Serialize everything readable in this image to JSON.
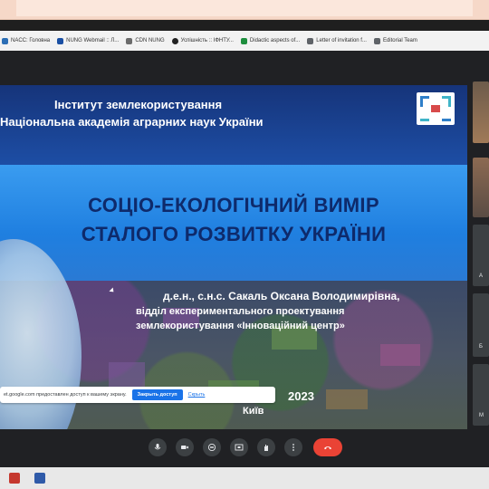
{
  "browser": {
    "bookmarks": [
      {
        "label": "NACC: Головна",
        "icon": "nacc-icon",
        "color": "#2c6eb5"
      },
      {
        "label": "NUNG Webmail :: Л...",
        "icon": "mail-icon",
        "color": "#1a4fa3"
      },
      {
        "label": "CDN NUNG",
        "icon": "doc-icon",
        "color": "#6b6b6b"
      },
      {
        "label": "Успішність :: ІФНТУ...",
        "icon": "github-icon",
        "color": "#222222"
      },
      {
        "label": "Didactic aspects of...",
        "icon": "sheet-icon",
        "color": "#1e8e3e"
      },
      {
        "label": "Letter of invitation f...",
        "icon": "letter-icon",
        "color": "#5f6368"
      },
      {
        "label": "Editorial Team",
        "icon": "editorial-icon",
        "color": "#5f6368"
      }
    ]
  },
  "slide": {
    "institute_line1": "Інститут землекористування",
    "institute_line2": "Національна академія аграрних наук України",
    "title_line1": "СОЦІО-ЕКОЛОГІЧНИЙ ВИМІР",
    "title_line2": "СТАЛОГО РОЗВИТКУ УКРАЇНИ",
    "author_line1": "д.е.н., с.н.с. Сакаль Оксана Володимирівна,",
    "author_line2": "відділ експериментального проектування",
    "author_line3": "землекористування «Інноваційний центр»",
    "year": "2023",
    "city": "Київ"
  },
  "share_banner": {
    "text": "et.google.com предоставлен доступ к вашему экрану.",
    "stop_label": "Закрыть доступ",
    "hide_label": "Скрыть"
  },
  "participants": {
    "tiles": [
      {
        "label": ""
      },
      {
        "label": ""
      },
      {
        "label": "А"
      },
      {
        "label": "Б"
      },
      {
        "label": "М"
      }
    ]
  },
  "controls": {
    "items": [
      "mic-icon",
      "camera-icon",
      "captions-icon",
      "present-icon",
      "raise-hand-icon",
      "more-icon",
      "end-call-icon"
    ]
  },
  "colors": {
    "meet_bg": "#202124",
    "end_call": "#ea4335",
    "title_text": "#0e2a6b",
    "accent_blue": "#1a73e8"
  }
}
